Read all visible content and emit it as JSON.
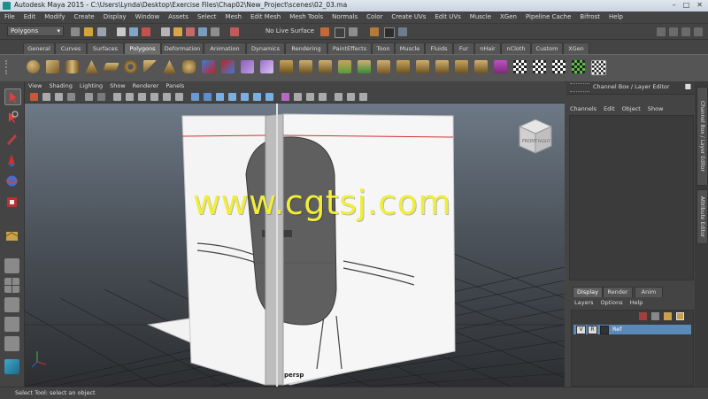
{
  "window": {
    "title": "Autodesk Maya 2015 - C:\\Users\\Lynda\\Desktop\\Exercise Files\\Chap02\\New_Project\\scenes\\02_03.ma"
  },
  "menubar": [
    "File",
    "Edit",
    "Modify",
    "Create",
    "Display",
    "Window",
    "Assets",
    "Select",
    "Mesh",
    "Edit Mesh",
    "Mesh Tools",
    "Normals",
    "Color",
    "Create UVs",
    "Edit UVs",
    "Muscle",
    "XGen",
    "Pipeline Cache",
    "Bifrost",
    "Help"
  ],
  "status_line": {
    "menu_set": "Polygons",
    "live_surface": "No Live Surface"
  },
  "shelf_tabs": [
    "General",
    "Curves",
    "Surfaces",
    "Polygons",
    "Deformation",
    "Animation",
    "Dynamics",
    "Rendering",
    "PaintEffects",
    "Toon",
    "Muscle",
    "Fluids",
    "Fur",
    "nHair",
    "nCloth",
    "Custom",
    "XGen"
  ],
  "active_shelf_tab": "Polygons",
  "viewport": {
    "menu": [
      "View",
      "Shading",
      "Lighting",
      "Show",
      "Renderer",
      "Panels"
    ],
    "camera_label": "persp",
    "watermark": "www.cgtsj.com",
    "viewcube": {
      "front": "FRONT",
      "right": "RIGHT"
    }
  },
  "channel_box": {
    "header": "Channel Box / Layer Editor",
    "menu": [
      "Channels",
      "Edit",
      "Object",
      "Show"
    ]
  },
  "side_tabs": [
    "Channel Box / Layer Editor",
    "Attribute Editor"
  ],
  "layer_editor": {
    "tabs": [
      "Display",
      "Render",
      "Anim"
    ],
    "active_tab": "Display",
    "menu": [
      "Layers",
      "Options",
      "Help"
    ],
    "layers": [
      {
        "visible": "V",
        "reference": "R",
        "name": "Ref"
      }
    ]
  },
  "help_line": "Select Tool: select an object",
  "colors": {
    "accent": "#5b8ab8",
    "watermark": "#f0ee3a",
    "background": "#444444"
  }
}
